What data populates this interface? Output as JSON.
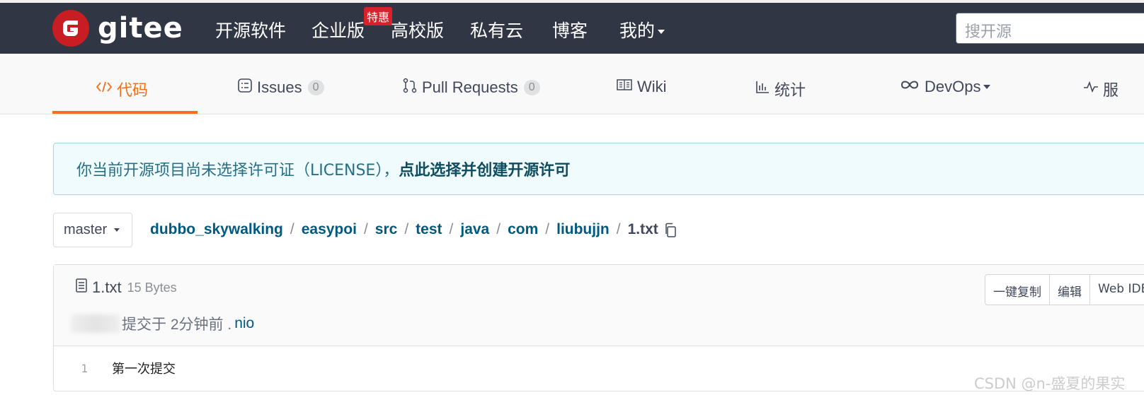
{
  "topnav": {
    "logo_text": "gitee",
    "items": [
      {
        "label": "开源软件"
      },
      {
        "label": "企业版"
      },
      {
        "label": "高校版"
      },
      {
        "label": "私有云"
      },
      {
        "label": "博客"
      },
      {
        "label": "我的"
      }
    ],
    "special_badge": "特惠",
    "search_placeholder": "搜开源",
    "background_color": "#303643",
    "brand_color": "#c71d23"
  },
  "tabs": [
    {
      "label": "代码",
      "icon": "code-icon",
      "active": true
    },
    {
      "label": "Issues",
      "icon": "issues-icon",
      "count": "0"
    },
    {
      "label": "Pull Requests",
      "icon": "pull-request-icon",
      "count": "0"
    },
    {
      "label": "Wiki",
      "icon": "book-icon"
    },
    {
      "label": "统计",
      "icon": "bar-chart-icon"
    },
    {
      "label": "DevOps",
      "icon": "infinity-icon"
    },
    {
      "label": "服",
      "icon": "pulse-icon"
    }
  ],
  "accent_color": "#f2711c",
  "notice": {
    "text": "你当前开源项目尚未选择许可证（LICENSE），",
    "link": "点此选择并创建开源许可"
  },
  "branch": {
    "selected": "master"
  },
  "breadcrumb": [
    "dubbo_skywalking",
    "easypoi",
    "src",
    "test",
    "java",
    "com",
    "liubujjn",
    "1.txt"
  ],
  "file": {
    "name": "1.txt",
    "size": "15 Bytes",
    "commit_text": "提交于 2分钟前 .",
    "commit_user": "nio",
    "buttons": [
      "一键复制",
      "编辑",
      "Web IDE"
    ],
    "lines": [
      {
        "number": "1",
        "content": "第一次提交"
      }
    ]
  },
  "watermark": "CSDN @n-盛夏的果实"
}
